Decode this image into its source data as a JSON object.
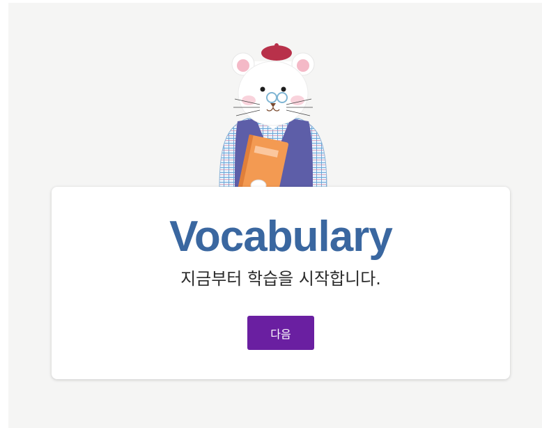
{
  "card": {
    "title": "Vocabulary",
    "subtitle": "지금부터 학습을 시작합니다.",
    "next_label": "다음"
  },
  "mascot": {
    "icon": "cat-teacher-illustration",
    "accent_colors": {
      "beret": "#b8314a",
      "vest": "#5d5ea8",
      "book": "#f39a52",
      "shirt_grid": "#6aa7d8"
    }
  },
  "colors": {
    "background": "#f5f5f4",
    "title": "#3a67a0",
    "button": "#6a1fa1"
  }
}
